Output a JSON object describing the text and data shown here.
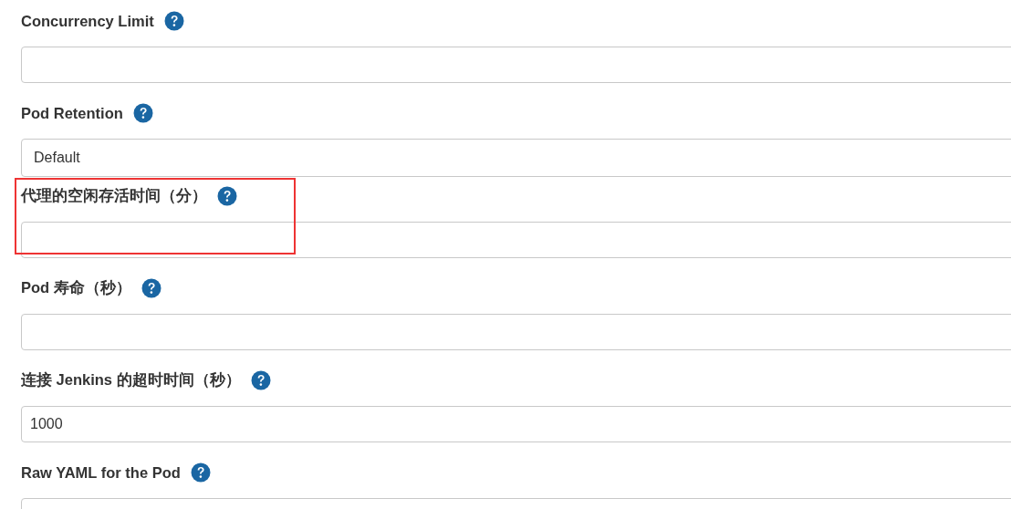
{
  "fields": [
    {
      "label": "Concurrency Limit",
      "kind": "text",
      "highlighted": false
    },
    {
      "label": "Pod Retention",
      "kind": "select",
      "value": "Default",
      "highlighted": false
    },
    {
      "label": "代理的空闲存活时间（分）",
      "kind": "text",
      "highlighted": true
    },
    {
      "label": "Pod 寿命（秒）",
      "kind": "text",
      "highlighted": false
    },
    {
      "label": "连接 Jenkins 的超时时间（秒）",
      "kind": "text",
      "value": "1000",
      "highlighted": false
    },
    {
      "label": "Raw YAML for the Pod",
      "kind": "textarea",
      "highlighted": false
    }
  ]
}
